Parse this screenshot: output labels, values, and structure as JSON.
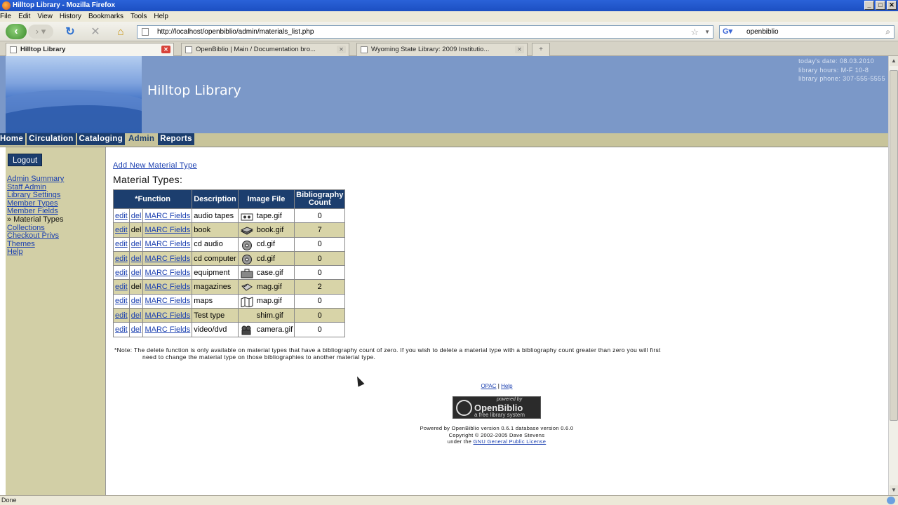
{
  "window": {
    "title": "Hilltop Library - Mozilla Firefox",
    "buttons": [
      "_",
      "□",
      "✕"
    ]
  },
  "menu": [
    "File",
    "Edit",
    "View",
    "History",
    "Bookmarks",
    "Tools",
    "Help"
  ],
  "toolbar": {
    "url": "http://localhost/openbiblio/admin/materials_list.php",
    "search_value": "openbiblio",
    "search_engine_icon": "google-icon"
  },
  "tabs": [
    {
      "label": "Hilltop Library",
      "active": true
    },
    {
      "label": "OpenBiblio | Main / Documentation bro...",
      "active": false
    },
    {
      "label": "Wyoming State Library: 2009 Institutio...",
      "active": false
    }
  ],
  "library": {
    "name": "Hilltop Library",
    "info": [
      "today's date:  08.03.2010",
      "library hours:  M-F 10-8",
      "library phone:  307-555-5555"
    ],
    "nav_tabs": [
      {
        "label": "Home",
        "active": false
      },
      {
        "label": "Circulation",
        "active": false
      },
      {
        "label": "Cataloging",
        "active": false
      },
      {
        "label": "Admin",
        "active": true
      },
      {
        "label": "Reports",
        "active": false
      }
    ]
  },
  "sidebar": {
    "logout_label": "Logout",
    "links": [
      {
        "label": "Admin Summary",
        "current": false
      },
      {
        "label": "Staff Admin",
        "current": false
      },
      {
        "label": "Library Settings",
        "current": false
      },
      {
        "label": "Member Types",
        "current": false
      },
      {
        "label": "Member Fields",
        "current": false
      },
      {
        "label": "» Material Types",
        "current": true
      },
      {
        "label": "Collections",
        "current": false
      },
      {
        "label": "Checkout Privs",
        "current": false
      },
      {
        "label": "Themes",
        "current": false
      },
      {
        "label": "Help",
        "current": false
      }
    ]
  },
  "main": {
    "add_link": "Add New Material Type",
    "heading": "Material Types:",
    "columns": [
      "*Function",
      "Description",
      "Image File",
      "Bibliography Count"
    ],
    "row_actions": {
      "edit": "edit",
      "del": "del",
      "marc": "MARC Fields"
    },
    "rows": [
      {
        "description": "audio tapes",
        "image": "tape.gif",
        "icon": "tape-icon",
        "count": "0",
        "del_link": true
      },
      {
        "description": "book",
        "image": "book.gif",
        "icon": "book-icon",
        "count": "7",
        "del_link": false
      },
      {
        "description": "cd audio",
        "image": "cd.gif",
        "icon": "cd-icon",
        "count": "0",
        "del_link": true
      },
      {
        "description": "cd computer",
        "image": "cd.gif",
        "icon": "cd-icon",
        "count": "0",
        "del_link": true
      },
      {
        "description": "equipment",
        "image": "case.gif",
        "icon": "case-icon",
        "count": "0",
        "del_link": true
      },
      {
        "description": "magazines",
        "image": "mag.gif",
        "icon": "magazine-icon",
        "count": "2",
        "del_link": false
      },
      {
        "description": "maps",
        "image": "map.gif",
        "icon": "map-icon",
        "count": "0",
        "del_link": true
      },
      {
        "description": "Test type",
        "image": "shim.gif",
        "icon": "",
        "count": "0",
        "del_link": true
      },
      {
        "description": "video/dvd",
        "image": "camera.gif",
        "icon": "camera-icon",
        "count": "0",
        "del_link": true
      }
    ],
    "note_line1": "*Note: The delete function is only available on material types that have a bibliography count of zero.  If you wish to delete a material type with a bibliography count greater than zero you will first",
    "note_line2": "need to change the material type on those bibliographies to another material type."
  },
  "footer": {
    "opac": "OPAC",
    "separator": "|",
    "help": "Help",
    "logo_powered": "powered by",
    "logo_name": "OpenBiblio",
    "logo_tagline": "a free library system",
    "credit1": "Powered by OpenBiblio version 0.6.1 database version 0.6.0",
    "credit2": "Copyright © 2002-2005 Dave Stevens",
    "credit3_prefix": "under the",
    "credit3_link": "GNU General Public License"
  },
  "status": "Done"
}
